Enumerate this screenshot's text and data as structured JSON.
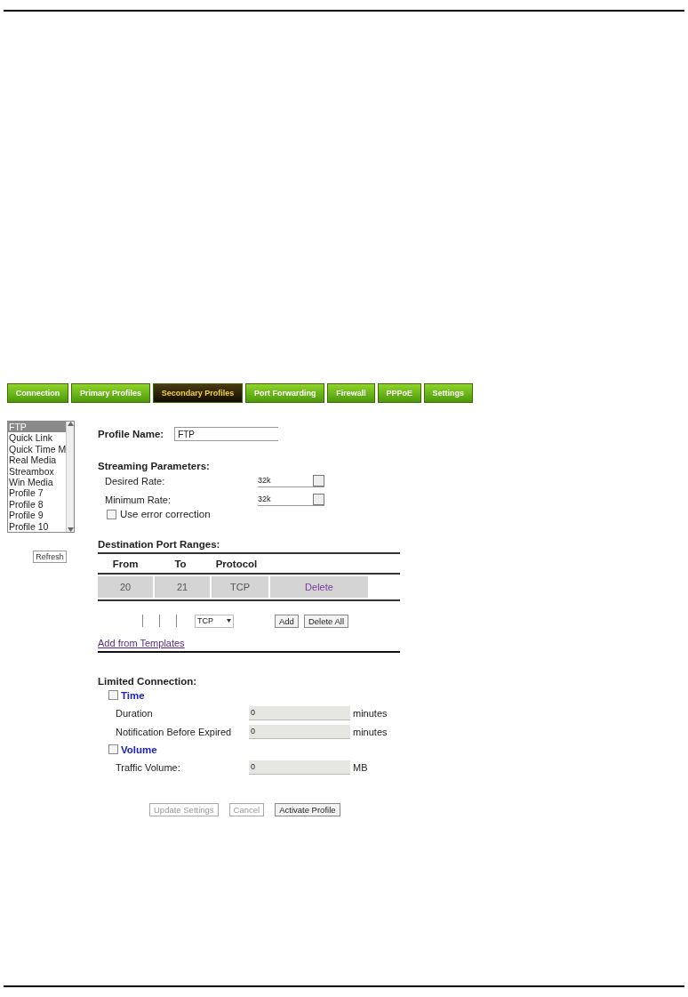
{
  "tabs": [
    {
      "label": "Connection",
      "selected": false
    },
    {
      "label": "Primary Profiles",
      "selected": false
    },
    {
      "label": "Secondary Profiles",
      "selected": true
    },
    {
      "label": "Port Forwarding",
      "selected": false
    },
    {
      "label": "Firewall",
      "selected": false
    },
    {
      "label": "PPPoE",
      "selected": false
    },
    {
      "label": "Settings",
      "selected": false
    }
  ],
  "profile_list": {
    "items": [
      {
        "label": "FTP",
        "selected": true
      },
      {
        "label": "Quick Link",
        "selected": false
      },
      {
        "label": "Quick Time M",
        "selected": false
      },
      {
        "label": "Real Media",
        "selected": false
      },
      {
        "label": "Streambox",
        "selected": false
      },
      {
        "label": "Win Media",
        "selected": false
      },
      {
        "label": "Profile 7",
        "selected": false
      },
      {
        "label": "Profile 8",
        "selected": false
      },
      {
        "label": "Profile 9",
        "selected": false
      },
      {
        "label": "Profile 10",
        "selected": false
      }
    ],
    "refresh_button": "Refresh"
  },
  "profile_name": {
    "label": "Profile Name:",
    "value": "FTP"
  },
  "streaming": {
    "heading": "Streaming Parameters:",
    "rates": [
      {
        "label": "Desired Rate:",
        "value": "32k"
      },
      {
        "label": "Minimum Rate:",
        "value": "32k"
      }
    ],
    "error_correction": {
      "label": "Use error correction",
      "checked": false
    }
  },
  "port_ranges": {
    "heading": "Destination Port Ranges:",
    "columns": [
      "From",
      "To",
      "Protocol"
    ],
    "rows": [
      {
        "from": "20",
        "to": "21",
        "protocol": "TCP",
        "action": "Delete"
      }
    ],
    "new_row": {
      "protocol": "TCP",
      "add_button": "Add",
      "delete_all_button": "Delete All"
    },
    "template_link": "Add from Templates"
  },
  "limited_connection": {
    "heading": "Limited Connection:",
    "groups": [
      {
        "label": "Time",
        "checked": false,
        "fields": [
          {
            "label": "Duration",
            "value": "0",
            "unit": "minutes"
          },
          {
            "label": "Notification Before Expired",
            "value": "0",
            "unit": "minutes"
          }
        ]
      },
      {
        "label": "Volume",
        "checked": false,
        "fields": [
          {
            "label": "Traffic Volume:",
            "value": "0",
            "unit": "MB"
          }
        ]
      }
    ]
  },
  "buttons": [
    {
      "label": "Update Settings",
      "disabled": true
    },
    {
      "label": "Cancel",
      "disabled": true
    },
    {
      "label": "Activate Profile",
      "disabled": false
    }
  ]
}
